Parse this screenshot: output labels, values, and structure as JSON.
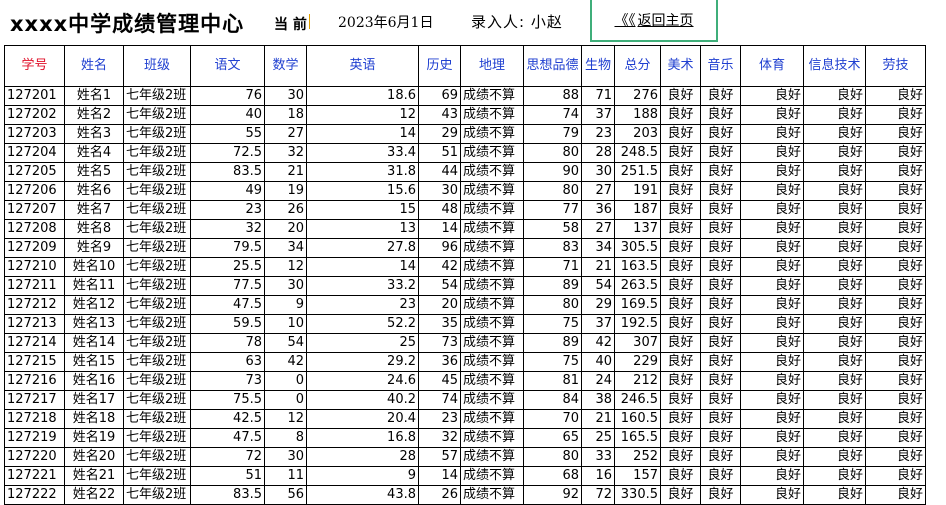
{
  "header": {
    "title": "xxxx中学成绩管理中心",
    "current_label": "当 前",
    "date": "2023年6月1日",
    "entry_by": "录入人:  小赵",
    "back_arrows": "《《",
    "back_label": "返回主页"
  },
  "table": {
    "columns": [
      "学号",
      "姓名",
      "班级",
      "语文",
      "数学",
      "英语",
      "历史",
      "地理",
      "思想品德",
      "生物",
      "总分",
      "美术",
      "音乐",
      "体育",
      "信息技术",
      "劳技"
    ],
    "rows": [
      [
        "127201",
        "姓名1",
        "七年级2班",
        "76",
        "30",
        "18.6",
        "69",
        "成绩不算",
        "88",
        "71",
        "276",
        "良好",
        "良好",
        "良好",
        "良好",
        "良好"
      ],
      [
        "127202",
        "姓名2",
        "七年级2班",
        "40",
        "18",
        "12",
        "43",
        "成绩不算",
        "74",
        "37",
        "188",
        "良好",
        "良好",
        "良好",
        "良好",
        "良好"
      ],
      [
        "127203",
        "姓名3",
        "七年级2班",
        "55",
        "27",
        "14",
        "29",
        "成绩不算",
        "79",
        "23",
        "203",
        "良好",
        "良好",
        "良好",
        "良好",
        "良好"
      ],
      [
        "127204",
        "姓名4",
        "七年级2班",
        "72.5",
        "32",
        "33.4",
        "51",
        "成绩不算",
        "80",
        "28",
        "248.5",
        "良好",
        "良好",
        "良好",
        "良好",
        "良好"
      ],
      [
        "127205",
        "姓名5",
        "七年级2班",
        "83.5",
        "21",
        "31.8",
        "44",
        "成绩不算",
        "90",
        "30",
        "251.5",
        "良好",
        "良好",
        "良好",
        "良好",
        "良好"
      ],
      [
        "127206",
        "姓名6",
        "七年级2班",
        "49",
        "19",
        "15.6",
        "30",
        "成绩不算",
        "80",
        "27",
        "191",
        "良好",
        "良好",
        "良好",
        "良好",
        "良好"
      ],
      [
        "127207",
        "姓名7",
        "七年级2班",
        "23",
        "26",
        "15",
        "48",
        "成绩不算",
        "77",
        "36",
        "187",
        "良好",
        "良好",
        "良好",
        "良好",
        "良好"
      ],
      [
        "127208",
        "姓名8",
        "七年级2班",
        "32",
        "20",
        "13",
        "14",
        "成绩不算",
        "58",
        "27",
        "137",
        "良好",
        "良好",
        "良好",
        "良好",
        "良好"
      ],
      [
        "127209",
        "姓名9",
        "七年级2班",
        "79.5",
        "34",
        "27.8",
        "96",
        "成绩不算",
        "83",
        "34",
        "305.5",
        "良好",
        "良好",
        "良好",
        "良好",
        "良好"
      ],
      [
        "127210",
        "姓名10",
        "七年级2班",
        "25.5",
        "12",
        "14",
        "42",
        "成绩不算",
        "71",
        "21",
        "163.5",
        "良好",
        "良好",
        "良好",
        "良好",
        "良好"
      ],
      [
        "127211",
        "姓名11",
        "七年级2班",
        "77.5",
        "30",
        "33.2",
        "54",
        "成绩不算",
        "89",
        "54",
        "263.5",
        "良好",
        "良好",
        "良好",
        "良好",
        "良好"
      ],
      [
        "127212",
        "姓名12",
        "七年级2班",
        "47.5",
        "9",
        "23",
        "20",
        "成绩不算",
        "80",
        "29",
        "169.5",
        "良好",
        "良好",
        "良好",
        "良好",
        "良好"
      ],
      [
        "127213",
        "姓名13",
        "七年级2班",
        "59.5",
        "10",
        "52.2",
        "35",
        "成绩不算",
        "75",
        "37",
        "192.5",
        "良好",
        "良好",
        "良好",
        "良好",
        "良好"
      ],
      [
        "127214",
        "姓名14",
        "七年级2班",
        "78",
        "54",
        "25",
        "73",
        "成绩不算",
        "89",
        "42",
        "307",
        "良好",
        "良好",
        "良好",
        "良好",
        "良好"
      ],
      [
        "127215",
        "姓名15",
        "七年级2班",
        "63",
        "42",
        "29.2",
        "36",
        "成绩不算",
        "75",
        "40",
        "229",
        "良好",
        "良好",
        "良好",
        "良好",
        "良好"
      ],
      [
        "127216",
        "姓名16",
        "七年级2班",
        "73",
        "0",
        "24.6",
        "45",
        "成绩不算",
        "81",
        "24",
        "212",
        "良好",
        "良好",
        "良好",
        "良好",
        "良好"
      ],
      [
        "127217",
        "姓名17",
        "七年级2班",
        "75.5",
        "0",
        "40.2",
        "74",
        "成绩不算",
        "84",
        "38",
        "246.5",
        "良好",
        "良好",
        "良好",
        "良好",
        "良好"
      ],
      [
        "127218",
        "姓名18",
        "七年级2班",
        "42.5",
        "12",
        "20.4",
        "23",
        "成绩不算",
        "70",
        "21",
        "160.5",
        "良好",
        "良好",
        "良好",
        "良好",
        "良好"
      ],
      [
        "127219",
        "姓名19",
        "七年级2班",
        "47.5",
        "8",
        "16.8",
        "32",
        "成绩不算",
        "65",
        "25",
        "165.5",
        "良好",
        "良好",
        "良好",
        "良好",
        "良好"
      ],
      [
        "127220",
        "姓名20",
        "七年级2班",
        "72",
        "30",
        "28",
        "57",
        "成绩不算",
        "80",
        "33",
        "252",
        "良好",
        "良好",
        "良好",
        "良好",
        "良好"
      ],
      [
        "127221",
        "姓名21",
        "七年级2班",
        "51",
        "11",
        "9",
        "14",
        "成绩不算",
        "68",
        "16",
        "157",
        "良好",
        "良好",
        "良好",
        "良好",
        "良好"
      ],
      [
        "127222",
        "姓名22",
        "七年级2班",
        "83.5",
        "56",
        "43.8",
        "26",
        "成绩不算",
        "92",
        "72",
        "330.5",
        "良好",
        "良好",
        "良好",
        "良好",
        "良好"
      ]
    ]
  }
}
